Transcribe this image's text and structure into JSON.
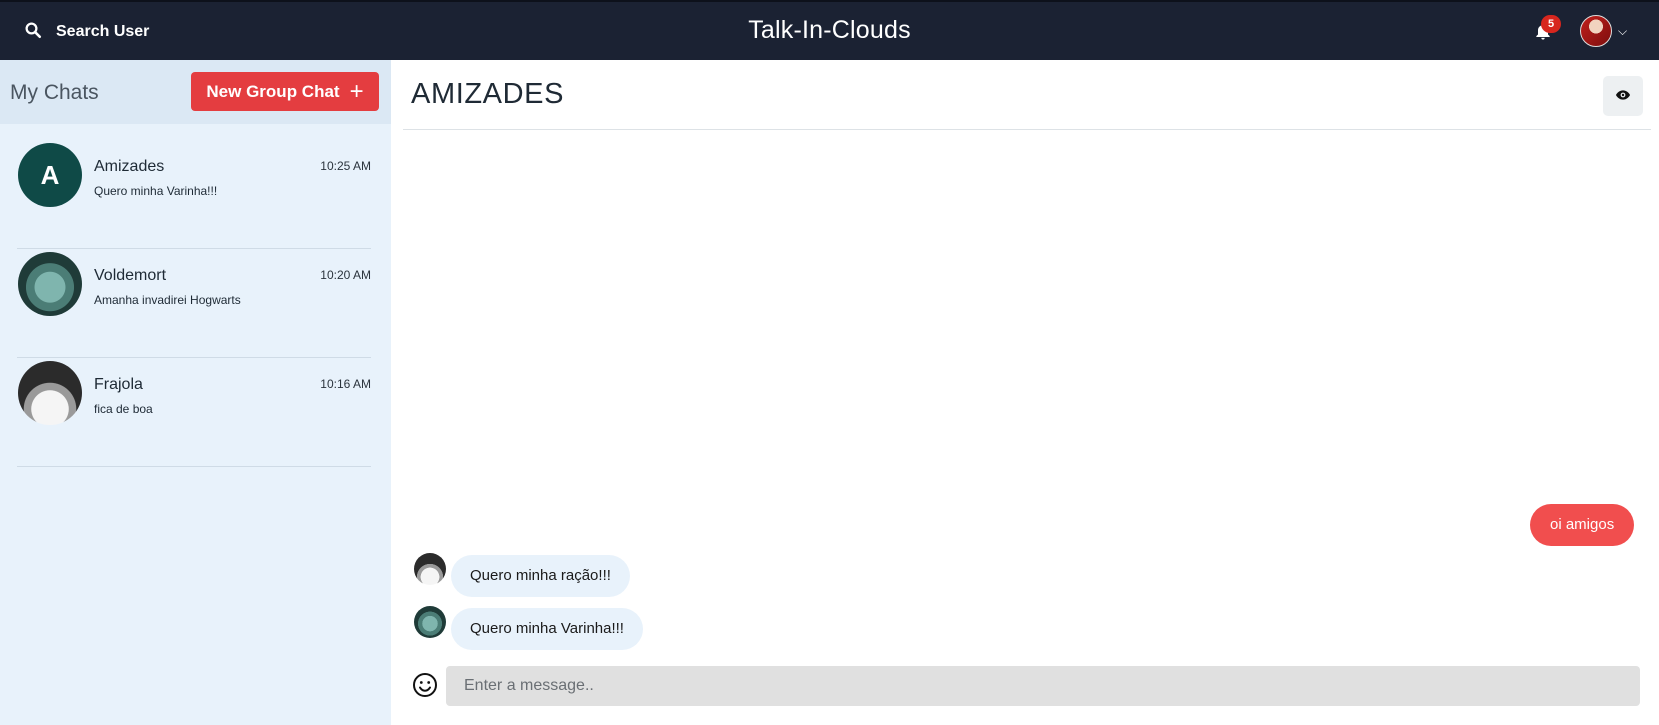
{
  "topbar": {
    "search_label": "Search User",
    "app_title": "Talk-In-Clouds",
    "notification_count": "5"
  },
  "sidebar": {
    "title": "My Chats",
    "new_group_label": "New Group Chat",
    "chats": [
      {
        "avatar_letter": "A",
        "name": "Amizades",
        "time": "10:25 AM",
        "preview": "Quero minha Varinha!!!"
      },
      {
        "name": "Voldemort",
        "time": "10:20 AM",
        "preview": "Amanha invadirei Hogwarts"
      },
      {
        "name": "Frajola",
        "time": "10:16 AM",
        "preview": "fica de boa"
      }
    ]
  },
  "main": {
    "chat_title": "AMIZADES",
    "messages": [
      {
        "direction": "outgoing",
        "text": "oi amigos"
      },
      {
        "direction": "incoming",
        "sender": "Frajola",
        "text": "Quero minha ração!!!"
      },
      {
        "direction": "incoming",
        "sender": "Voldemort",
        "text": "Quero minha Varinha!!!"
      }
    ],
    "input_placeholder": "Enter a message.."
  },
  "colors": {
    "topbar_bg": "#1b2233",
    "accent_red": "#e43d40",
    "outgoing_bubble": "#f14e4e",
    "incoming_bubble": "#e8f2fb",
    "sidebar_bg": "#e8f2fb",
    "group_avatar_bg": "#0f4a47"
  }
}
